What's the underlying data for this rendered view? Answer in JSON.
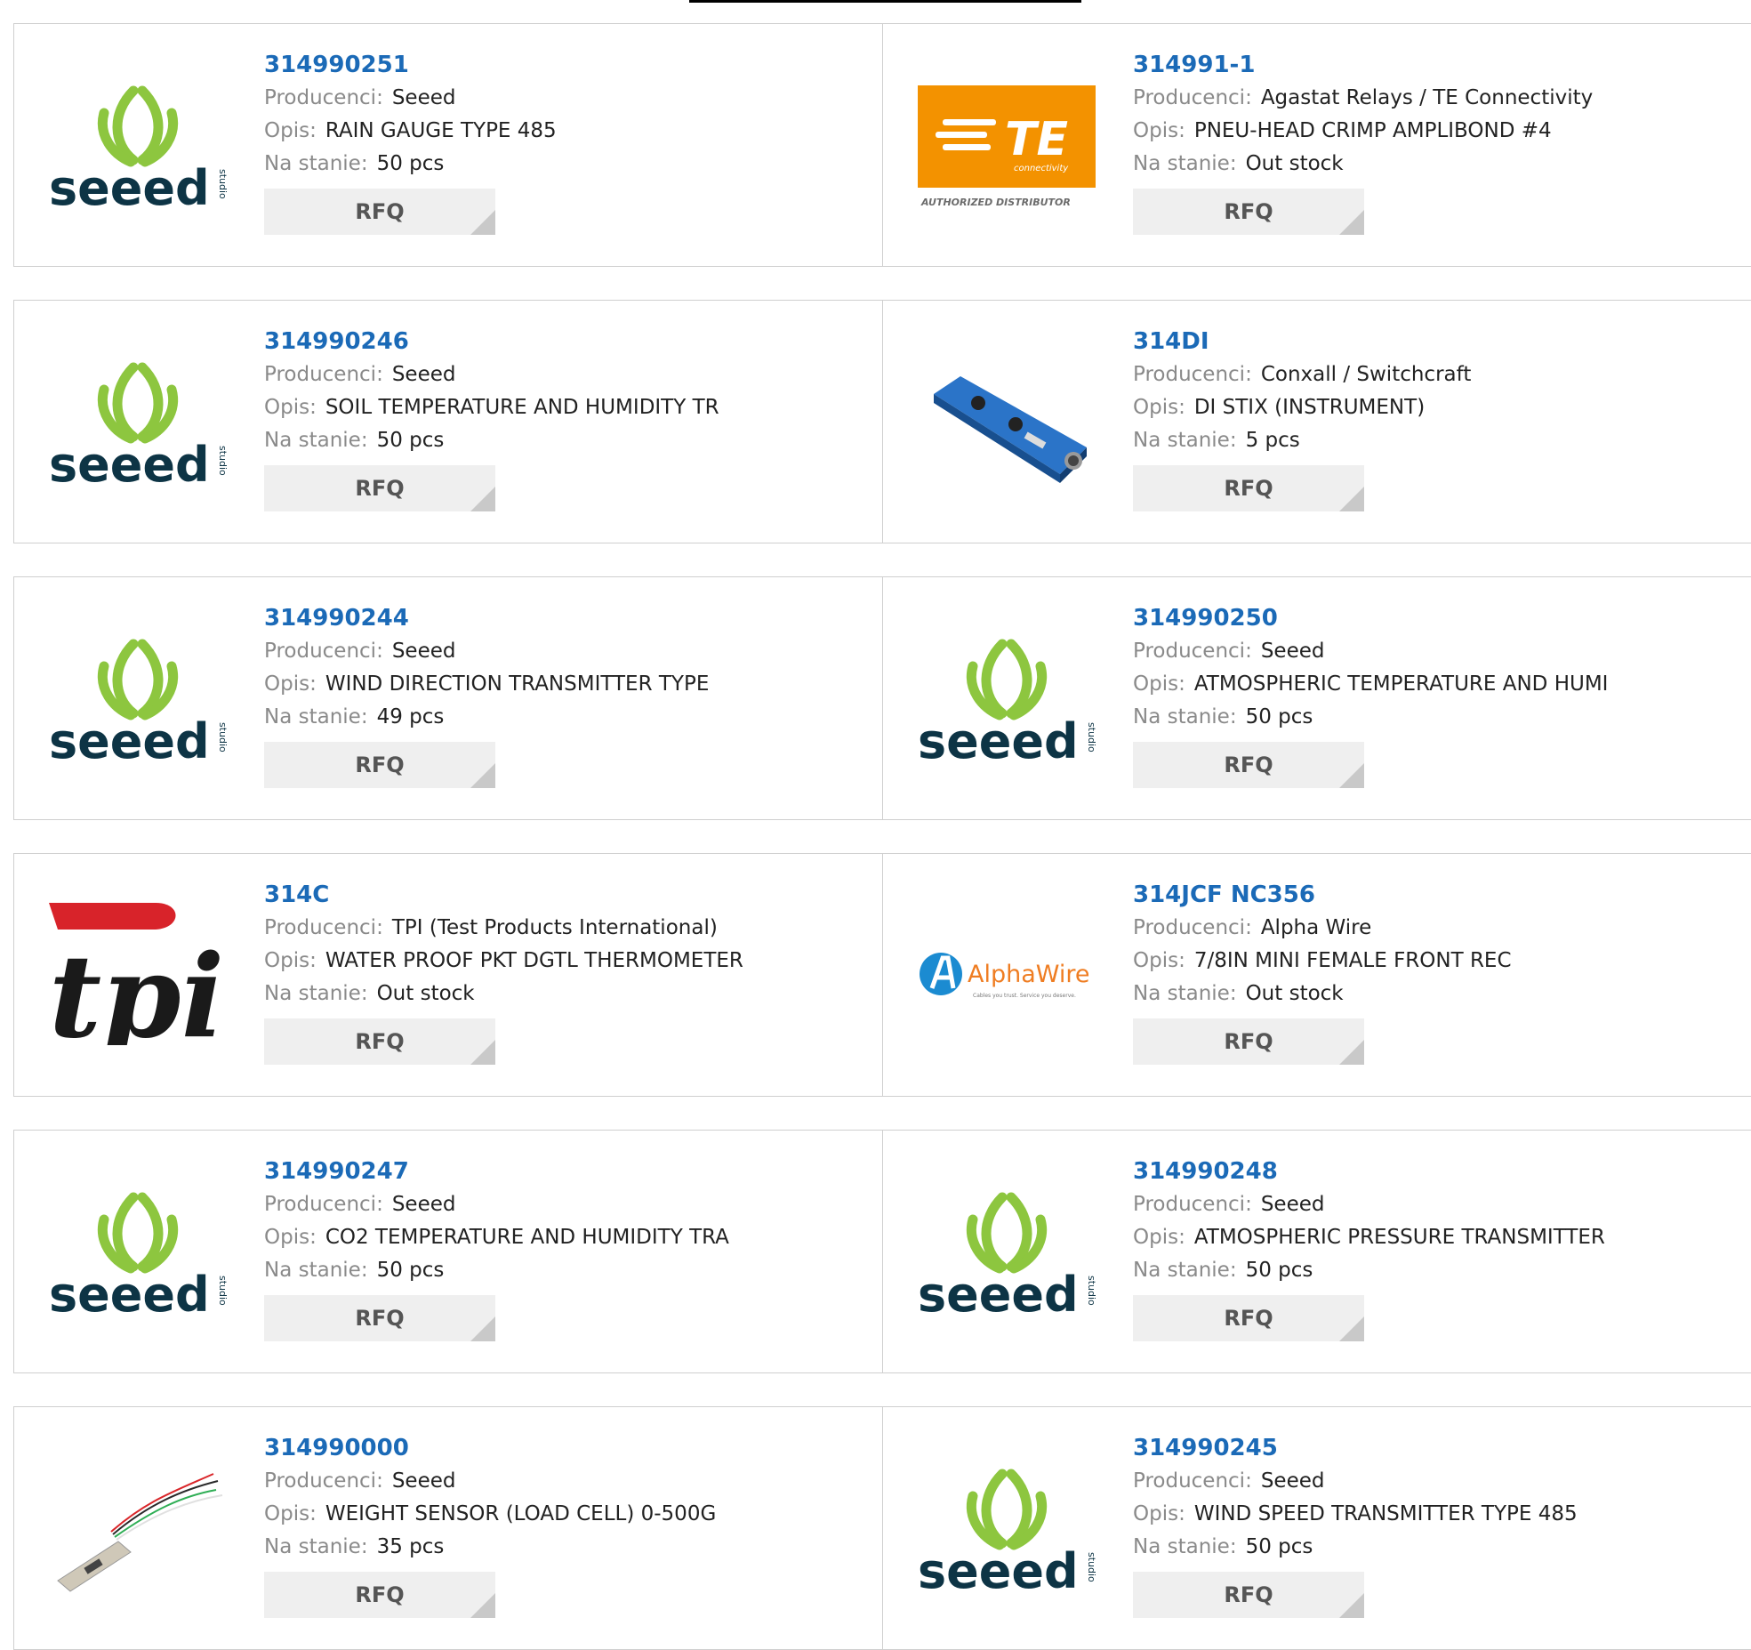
{
  "labels": {
    "manufacturer": "Producenci:",
    "description": "Opis:",
    "stock": "Na stanie:",
    "rfq": "RFQ"
  },
  "products": [
    {
      "part": "314990251",
      "manufacturer": "Seeed",
      "description": "RAIN GAUGE TYPE 485",
      "stock": "50 pcs",
      "logo": "seeed-logo"
    },
    {
      "part": "314991-1",
      "manufacturer": "Agastat Relays / TE Connectivity",
      "description": "PNEU-HEAD CRIMP AMPLIBOND #4",
      "stock": "Out stock",
      "logo": "te-connectivity-logo",
      "logo_text": "TE",
      "logo_subtext": "connectivity",
      "logo_caption": "AUTHORIZED DISTRIBUTOR"
    },
    {
      "part": "314990246",
      "manufacturer": "Seeed",
      "description": "SOIL TEMPERATURE AND HUMIDITY TR",
      "stock": "50 pcs",
      "logo": "seeed-logo"
    },
    {
      "part": "314DI",
      "manufacturer": "Conxall / Switchcraft",
      "description": "DI STIX (INSTRUMENT)",
      "stock": "5 pcs",
      "logo": "di-box-product-photo"
    },
    {
      "part": "314990244",
      "manufacturer": "Seeed",
      "description": "WIND DIRECTION TRANSMITTER TYPE",
      "stock": "49 pcs",
      "logo": "seeed-logo"
    },
    {
      "part": "314990250",
      "manufacturer": "Seeed",
      "description": "ATMOSPHERIC TEMPERATURE AND HUMI",
      "stock": "50 pcs",
      "logo": "seeed-logo"
    },
    {
      "part": "314C",
      "manufacturer": "TPI (Test Products International)",
      "description": "WATER PROOF PKT DGTL THERMOMETER",
      "stock": "Out stock",
      "logo": "tpi-logo",
      "logo_text": "tpi"
    },
    {
      "part": "314JCF NC356",
      "manufacturer": "Alpha Wire",
      "description": "7/8IN MINI FEMALE FRONT REC",
      "stock": "Out stock",
      "logo": "alphawire-logo",
      "logo_text": "AlphaWire",
      "logo_subtext": "Cables you trust. Service you deserve."
    },
    {
      "part": "314990247",
      "manufacturer": "Seeed",
      "description": "CO2 TEMPERATURE AND HUMIDITY TRA",
      "stock": "50 pcs",
      "logo": "seeed-logo"
    },
    {
      "part": "314990248",
      "manufacturer": "Seeed",
      "description": "ATMOSPHERIC PRESSURE TRANSMITTER",
      "stock": "50 pcs",
      "logo": "seeed-logo"
    },
    {
      "part": "314990000",
      "manufacturer": "Seeed",
      "description": "WEIGHT SENSOR (LOAD CELL) 0-500G",
      "stock": "35 pcs",
      "logo": "load-cell-product-photo"
    },
    {
      "part": "314990245",
      "manufacturer": "Seeed",
      "description": "WIND SPEED TRANSMITTER TYPE 485",
      "stock": "50 pcs",
      "logo": "seeed-logo"
    }
  ],
  "seeed_logo": {
    "word": "seeed",
    "side_word": "studio"
  },
  "colors": {
    "link": "#1b6ab7",
    "seeed_green": "#8dc63f",
    "seeed_dark": "#0d3445",
    "te_orange": "#f39200",
    "tpi_red": "#d8232a",
    "alphawire_blue": "#1b8bd1",
    "alphawire_orange": "#ef7d22"
  }
}
